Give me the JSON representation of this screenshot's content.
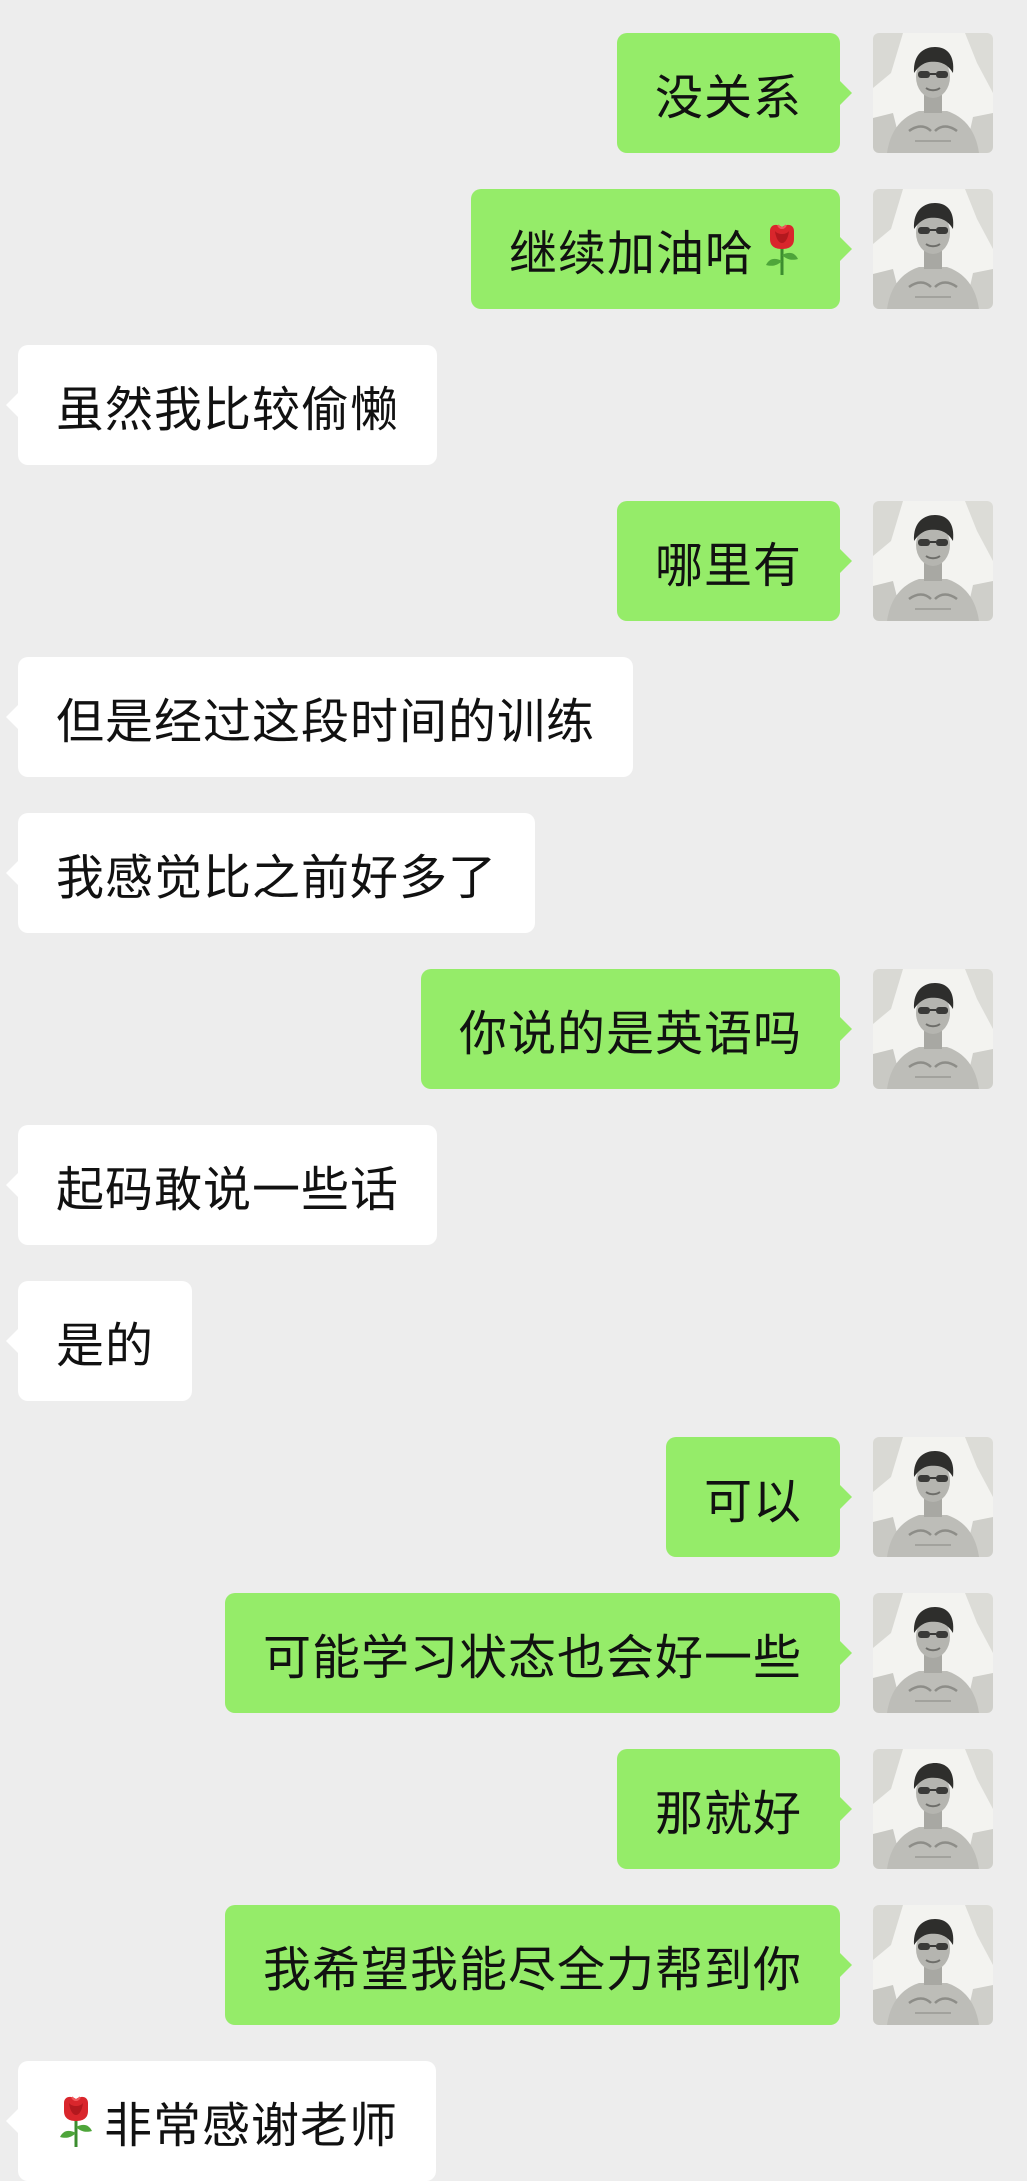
{
  "messages": [
    {
      "side": "sent",
      "text": "没关系"
    },
    {
      "side": "sent",
      "text": "继续加油哈",
      "emoji_after": "rose-emoji"
    },
    {
      "side": "received",
      "text": "虽然我比较偷懒"
    },
    {
      "side": "sent",
      "text": "哪里有"
    },
    {
      "side": "received",
      "text": "但是经过这段时间的训练"
    },
    {
      "side": "received",
      "text": "我感觉比之前好多了"
    },
    {
      "side": "sent",
      "text": "你说的是英语吗"
    },
    {
      "side": "received",
      "text": "起码敢说一些话"
    },
    {
      "side": "received",
      "text": "是的"
    },
    {
      "side": "sent",
      "text": "可以"
    },
    {
      "side": "sent",
      "text": "可能学习状态也会好一些"
    },
    {
      "side": "sent",
      "text": "那就好"
    },
    {
      "side": "sent",
      "text": "我希望我能尽全力帮到你"
    },
    {
      "side": "received",
      "text": "非常感谢老师",
      "emoji_before": "rose-emoji"
    }
  ],
  "theme": {
    "background": "#ededed",
    "sent_bubble": "#95ec69",
    "received_bubble": "#ffffff",
    "text": "#111111"
  },
  "avatar_icon": "user-avatar-photo"
}
